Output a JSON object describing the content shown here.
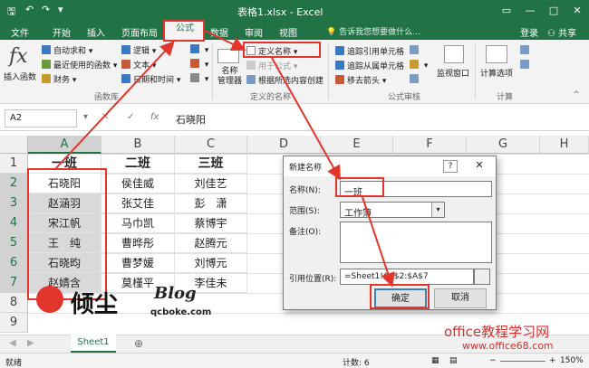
{
  "title_bar": {
    "doc_title": "表格1.xlsx - Excel",
    "restore_icon": "▭",
    "minimize_icon": "—",
    "maximize_icon": "□",
    "close_icon": "✕"
  },
  "tabs": [
    "文件",
    "开始",
    "插入",
    "页面布局",
    "公式",
    "数据",
    "审阅",
    "视图"
  ],
  "tell_me": "告诉我您想要做什么…",
  "account": {
    "login": "登录",
    "share": "共享"
  },
  "ribbon": {
    "insert_function": [
      "插入函数"
    ],
    "library_col1": [
      "自动求和",
      "最近使用的函数",
      "财务"
    ],
    "library_col2": [
      "逻辑",
      "文本",
      "日期和时间"
    ],
    "library_group": "函数库",
    "name_manager": [
      "名称",
      "管理器"
    ],
    "define_name": "定义名称",
    "use_in_formula": "用于公式",
    "create_from_selection": "根据所选内容创建",
    "names_group": "定义的名称",
    "audit_col1": [
      "追踪引用单元格",
      "追踪从属单元格",
      "移去箭头"
    ],
    "audit_group": "公式审核",
    "watch_window": "监视窗口",
    "calc_options": "计算选项",
    "calc_group": "计算"
  },
  "formula_bar": {
    "name_box": "A2",
    "cancel": "✕",
    "enter": "✓",
    "fx": "fx",
    "value": "石晓阳"
  },
  "columns": [
    "A",
    "B",
    "C",
    "D",
    "E",
    "F",
    "G",
    "H"
  ],
  "rows": [
    "1",
    "2",
    "3",
    "4",
    "5",
    "6",
    "7",
    "8",
    "9"
  ],
  "cells": [
    [
      "一班",
      "二班",
      "三班"
    ],
    [
      "石晓阳",
      "侯佳威",
      "刘佳艺"
    ],
    [
      "赵涵羽",
      "张艾佳",
      "彭　潇"
    ],
    [
      "宋江帆",
      "马巾凯",
      "蔡博宇"
    ],
    [
      "王　纯",
      "曹晔彤",
      "赵腾元"
    ],
    [
      "石晓昀",
      "曹梦媛",
      "刘博元"
    ],
    [
      "赵婧含",
      "莫槿平",
      "李佳未"
    ]
  ],
  "dialog": {
    "title": "新建名称",
    "help": "?",
    "close": "✕",
    "name_label": "名称(N):",
    "name_value": "一班",
    "scope_label": "范围(S):",
    "scope_value": "工作簿",
    "comment_label": "备注(O):",
    "ref_label": "引用位置(R):",
    "ref_value": "=Sheet1!$A$2:$A$7",
    "ok": "确定",
    "cancel": "取消"
  },
  "sheet": {
    "tab": "Sheet1",
    "add": "⊕"
  },
  "status": {
    "ready": "就绪",
    "count": "计数: 6",
    "zoom": "150%"
  },
  "watermarks": {
    "logo_text": "倾尘",
    "blog": "Blog",
    "blog_url": "qcboke.com",
    "site_name": "office教程学习网",
    "site_url": "www.office68.com"
  },
  "colors": {
    "excel_green": "#217346",
    "annotation_red": "#e2352c"
  }
}
